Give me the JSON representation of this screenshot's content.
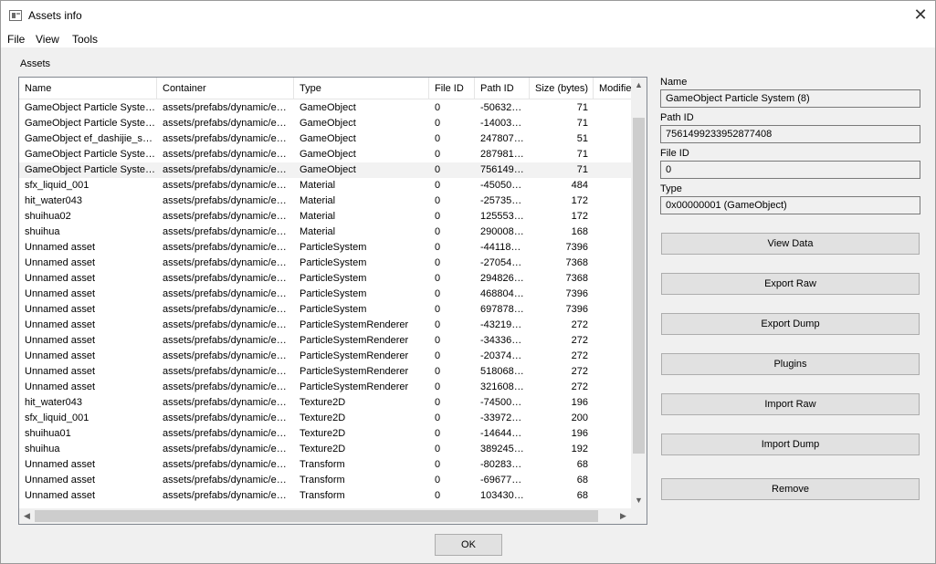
{
  "window": {
    "title": "Assets info"
  },
  "menu": [
    {
      "label": "File"
    },
    {
      "label": "View"
    },
    {
      "label": "Tools"
    }
  ],
  "assets_section": {
    "label": "Assets"
  },
  "table": {
    "headers": [
      "Name",
      "Container",
      "Type",
      "File ID",
      "Path ID",
      "Size (bytes)",
      "Modifie"
    ],
    "rows": [
      [
        "GameObject Particle Syste…",
        "assets/prefabs/dynamic/e…",
        "GameObject",
        "0",
        "-50632…",
        "71"
      ],
      [
        "GameObject Particle Syste…",
        "assets/prefabs/dynamic/e…",
        "GameObject",
        "0",
        "-14003…",
        "71"
      ],
      [
        "GameObject ef_dashijie_s…",
        "assets/prefabs/dynamic/e…",
        "GameObject",
        "0",
        "247807…",
        "51"
      ],
      [
        "GameObject Particle Syste…",
        "assets/prefabs/dynamic/e…",
        "GameObject",
        "0",
        "287981…",
        "71"
      ],
      [
        "GameObject Particle Syste…",
        "assets/prefabs/dynamic/e…",
        "GameObject",
        "0",
        "756149…",
        "71"
      ],
      [
        "sfx_liquid_001",
        "assets/prefabs/dynamic/e…",
        "Material",
        "0",
        "-45050…",
        "484"
      ],
      [
        "hit_water043",
        "assets/prefabs/dynamic/e…",
        "Material",
        "0",
        "-25735…",
        "172"
      ],
      [
        "shuihua02",
        "assets/prefabs/dynamic/e…",
        "Material",
        "0",
        "125553…",
        "172"
      ],
      [
        "shuihua",
        "assets/prefabs/dynamic/e…",
        "Material",
        "0",
        "290008…",
        "168"
      ],
      [
        "Unnamed asset",
        "assets/prefabs/dynamic/e…",
        "ParticleSystem",
        "0",
        "-44118…",
        "7396"
      ],
      [
        "Unnamed asset",
        "assets/prefabs/dynamic/e…",
        "ParticleSystem",
        "0",
        "-27054…",
        "7368"
      ],
      [
        "Unnamed asset",
        "assets/prefabs/dynamic/e…",
        "ParticleSystem",
        "0",
        "294826…",
        "7368"
      ],
      [
        "Unnamed asset",
        "assets/prefabs/dynamic/e…",
        "ParticleSystem",
        "0",
        "468804…",
        "7396"
      ],
      [
        "Unnamed asset",
        "assets/prefabs/dynamic/e…",
        "ParticleSystem",
        "0",
        "697878…",
        "7396"
      ],
      [
        "Unnamed asset",
        "assets/prefabs/dynamic/e…",
        "ParticleSystemRenderer",
        "0",
        "-43219…",
        "272"
      ],
      [
        "Unnamed asset",
        "assets/prefabs/dynamic/e…",
        "ParticleSystemRenderer",
        "0",
        "-34336…",
        "272"
      ],
      [
        "Unnamed asset",
        "assets/prefabs/dynamic/e…",
        "ParticleSystemRenderer",
        "0",
        "-20374…",
        "272"
      ],
      [
        "Unnamed asset",
        "assets/prefabs/dynamic/e…",
        "ParticleSystemRenderer",
        "0",
        "518068…",
        "272"
      ],
      [
        "Unnamed asset",
        "assets/prefabs/dynamic/e…",
        "ParticleSystemRenderer",
        "0",
        "321608…",
        "272"
      ],
      [
        "hit_water043",
        "assets/prefabs/dynamic/e…",
        "Texture2D",
        "0",
        "-74500…",
        "196"
      ],
      [
        "sfx_liquid_001",
        "assets/prefabs/dynamic/e…",
        "Texture2D",
        "0",
        "-33972…",
        "200"
      ],
      [
        "shuihua01",
        "assets/prefabs/dynamic/e…",
        "Texture2D",
        "0",
        "-14644…",
        "196"
      ],
      [
        "shuihua",
        "assets/prefabs/dynamic/e…",
        "Texture2D",
        "0",
        "389245…",
        "192"
      ],
      [
        "Unnamed asset",
        "assets/prefabs/dynamic/e…",
        "Transform",
        "0",
        "-80283…",
        "68"
      ],
      [
        "Unnamed asset",
        "assets/prefabs/dynamic/e…",
        "Transform",
        "0",
        "-69677…",
        "68"
      ],
      [
        "Unnamed asset",
        "assets/prefabs/dynamic/e…",
        "Transform",
        "0",
        "103430…",
        "68"
      ]
    ],
    "selected_row": 4
  },
  "details": {
    "name_label": "Name",
    "name_value": "GameObject Particle System (8)",
    "pathid_label": "Path ID",
    "pathid_value": "7561499233952877408",
    "fileid_label": "File ID",
    "fileid_value": "0",
    "type_label": "Type",
    "type_value": "0x00000001 (GameObject)"
  },
  "buttons": {
    "view_data": "View Data",
    "export_raw": "Export Raw",
    "export_dump": "Export Dump",
    "plugins": "Plugins",
    "import_raw": "Import Raw",
    "import_dump": "Import Dump",
    "remove": "Remove",
    "ok": "OK"
  },
  "icons": {
    "app": "window-app-icon",
    "close": "close-icon",
    "scroll_up": "chevron-up-icon",
    "scroll_down": "chevron-down-icon",
    "scroll_left": "chevron-left-icon",
    "scroll_right": "chevron-right-icon"
  }
}
